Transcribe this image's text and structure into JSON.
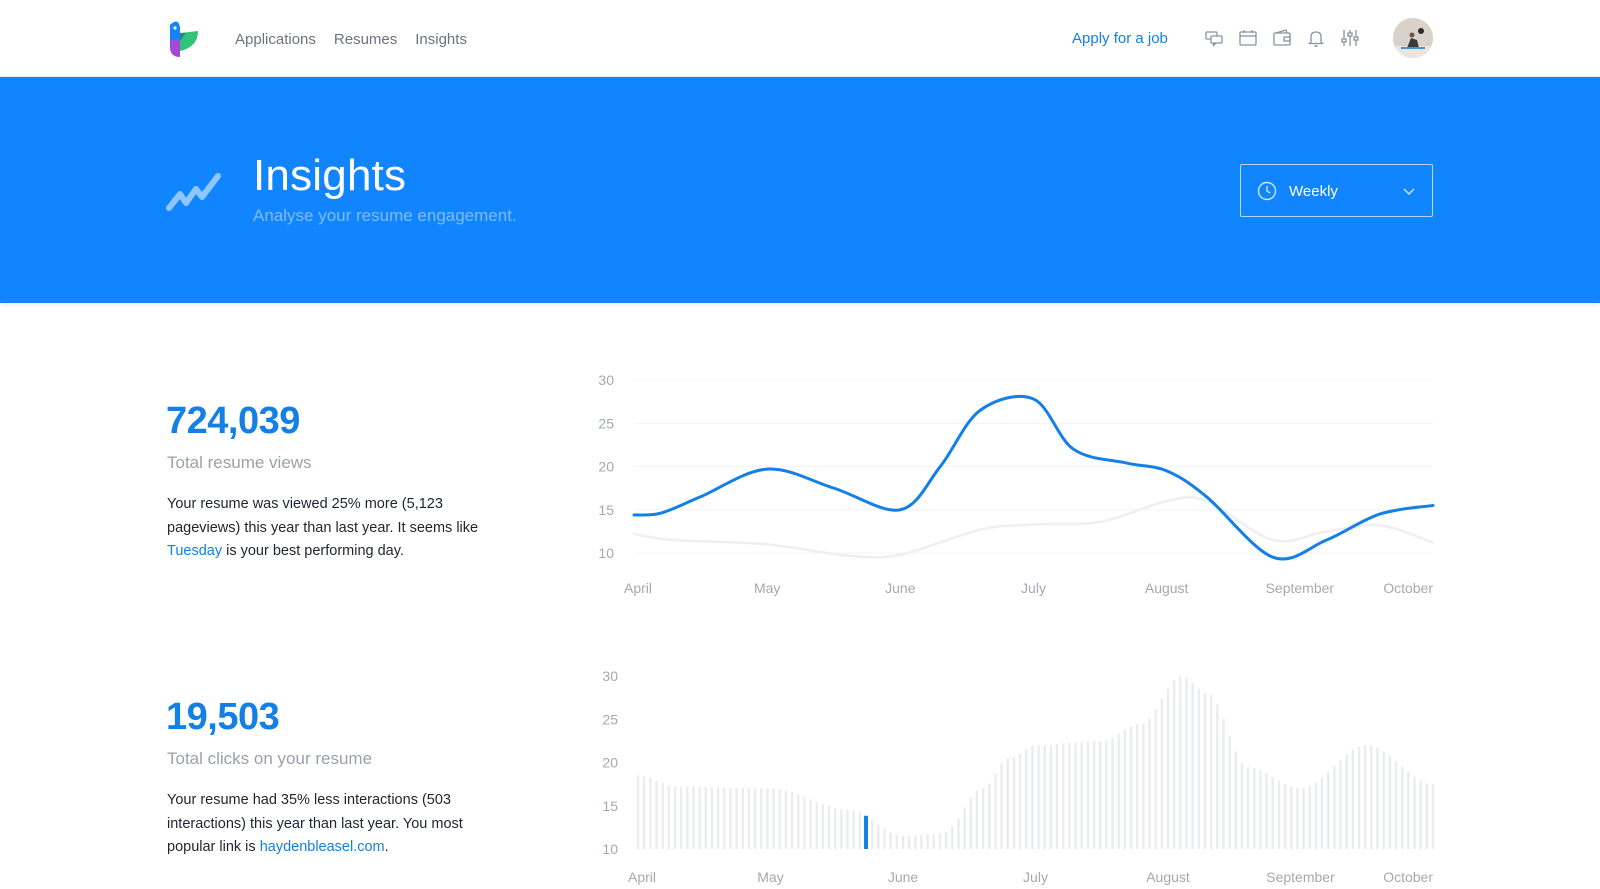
{
  "nav": {
    "items": [
      "Applications",
      "Resumes",
      "Insights"
    ],
    "apply_label": "Apply for a job",
    "icons": [
      "chat-icon",
      "calendar-icon",
      "wallet-icon",
      "bell-icon",
      "sliders-icon"
    ]
  },
  "hero": {
    "title": "Insights",
    "subtitle": "Analyse your resume engagement.",
    "period_select": "Weekly"
  },
  "stats": [
    {
      "value": "724,039",
      "label": "Total resume views",
      "desc_pre": "Your resume was viewed 25% more (5,123 pageviews) this year than last year. It seems like ",
      "desc_link": "Tuesday",
      "desc_post": " is your best performing day."
    },
    {
      "value": "19,503",
      "label": "Total clicks on your resume",
      "desc_pre": "Your resume had 35% less interactions (503 interactions) this year than last year. You most popular link is ",
      "desc_link": "haydenbleasel.com",
      "desc_post": "."
    }
  ],
  "colors": {
    "accent": "#1480e6",
    "hero_bg": "#1185fe",
    "secondary_line": "#eeeff1",
    "bar": "#e9eaec"
  },
  "chart_data": [
    {
      "type": "line",
      "x": [
        "April",
        "May",
        "June",
        "July",
        "August",
        "September",
        "October"
      ],
      "xlabels": [
        "April",
        "May",
        "June",
        "July",
        "August",
        "September",
        "October"
      ],
      "yticks": [
        10,
        15,
        20,
        25,
        30
      ],
      "ylim": [
        10,
        30
      ],
      "series": [
        {
          "values_x": [
            0,
            0.2,
            0.5,
            1.0,
            1.5,
            2.0,
            2.3,
            2.6,
            3.0,
            3.3,
            3.7,
            4.0,
            4.3,
            4.8,
            5.2,
            5.6,
            6.0
          ],
          "values": [
            14.4,
            14.6,
            16.5,
            19.7,
            17.5,
            15.0,
            20.0,
            26.5,
            27.8,
            22.0,
            20.4,
            19.5,
            16.5,
            9.5,
            11.5,
            14.5,
            15.5
          ],
          "color": "#1480e6"
        },
        {
          "values_x": [
            0,
            0.3,
            1.0,
            1.6,
            2.0,
            2.6,
            3.0,
            3.5,
            4.0,
            4.3,
            4.8,
            5.2,
            5.6,
            6.0
          ],
          "values": [
            12.2,
            11.5,
            11.0,
            9.7,
            9.8,
            12.7,
            13.3,
            13.6,
            16.0,
            16.0,
            11.5,
            12.5,
            13.2,
            11.2
          ],
          "color": "#eeeff1"
        }
      ]
    },
    {
      "type": "bar",
      "xlabels": [
        "April",
        "May",
        "June",
        "July",
        "August",
        "September",
        "October"
      ],
      "yticks": [
        10,
        15,
        20,
        25,
        30
      ],
      "ylim": [
        10,
        30
      ],
      "highlight_index": 37,
      "envelope_x": [
        0,
        0.3,
        1.0,
        1.6,
        2.0,
        2.3,
        2.6,
        2.8,
        3.0,
        3.5,
        3.8,
        4.1,
        4.3,
        4.6,
        5.0,
        5.5,
        6.0
      ],
      "envelope_y": [
        18.5,
        17.2,
        17.0,
        14.5,
        11.5,
        11.8,
        17.0,
        20.5,
        22.0,
        22.5,
        24.5,
        30.0,
        28.0,
        19.5,
        17.0,
        22.0,
        17.5
      ]
    }
  ]
}
